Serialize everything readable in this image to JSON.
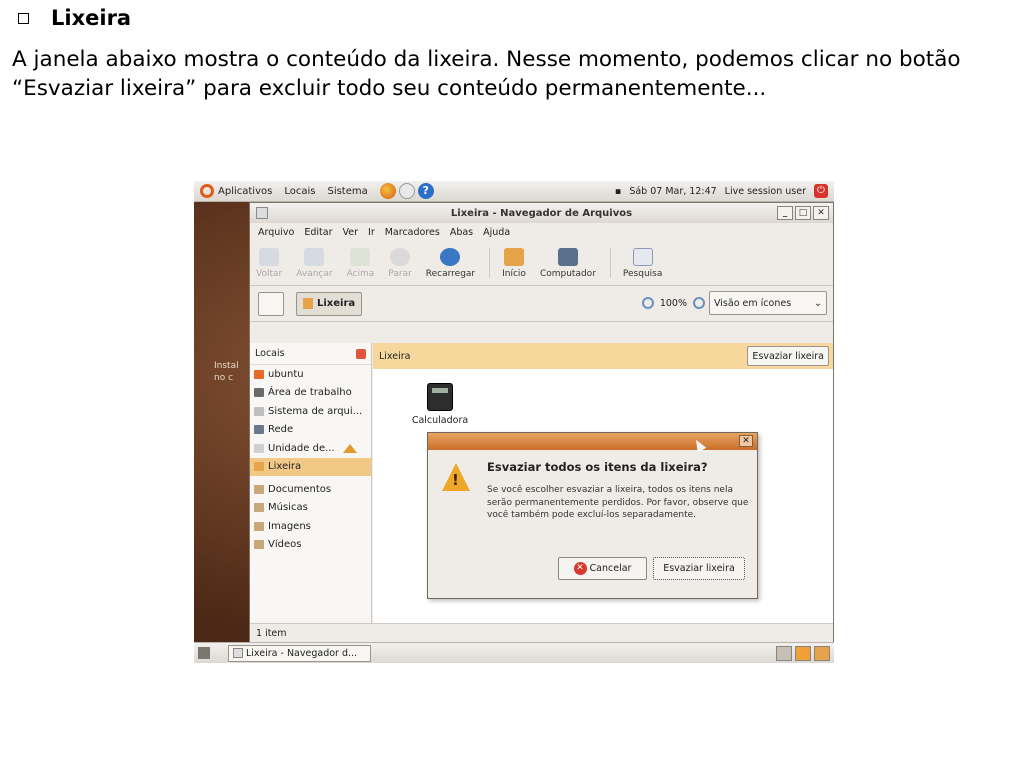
{
  "slide": {
    "title": "Lixeira",
    "body": "A janela abaixo mostra o conteúdo da lixeira. Nesse momento, podemos clicar no botão “Esvaziar lixeira” para excluir todo seu conteúdo permanentemente..."
  },
  "gnome_panel": {
    "menus": [
      "Aplicativos",
      "Locais",
      "Sistema"
    ],
    "datetime": "Sáb 07 Mar, 12:47",
    "user": "Live session user"
  },
  "desktop": {
    "text_line1": "Instal",
    "text_line2": "no c"
  },
  "window": {
    "title": "Lixeira - Navegador de Arquivos",
    "menu": [
      "Arquivo",
      "Editar",
      "Ver",
      "Ir",
      "Marcadores",
      "Abas",
      "Ajuda"
    ],
    "toolbar": {
      "back": "Voltar",
      "forward": "Avançar",
      "up": "Acima",
      "stop": "Parar",
      "reload": "Recarregar",
      "home": "Início",
      "computer": "Computador",
      "search": "Pesquisa"
    },
    "location": "Lixeira",
    "zoom": "100%",
    "view": "Visão em ícones",
    "sidebar": {
      "header": "Locais",
      "items": [
        "ubuntu",
        "Área de trabalho",
        "Sistema de arqui...",
        "Rede",
        "Unidade de...",
        "Lixeira",
        "Documentos",
        "Músicas",
        "Imagens",
        "Vídeos"
      ]
    },
    "info_bar": {
      "label": "Lixeira",
      "empty_button": "Esvaziar lixeira"
    },
    "files": [
      {
        "name": "Calculadora"
      }
    ],
    "status": "1 item"
  },
  "dialog": {
    "heading": "Esvaziar todos os itens da lixeira?",
    "text": "Se você escolher esvaziar a lixeira, todos os itens nela serão permanentemente perdidos. Por favor, observe que você também pode excluí-los separadamente.",
    "cancel": "Cancelar",
    "confirm": "Esvaziar lixeira"
  },
  "taskbar": {
    "task": "Lixeira - Navegador d..."
  },
  "colors": {
    "accent": "#f7d89c",
    "selected": "#f2c886",
    "dialog_title": "#c96d2a"
  }
}
